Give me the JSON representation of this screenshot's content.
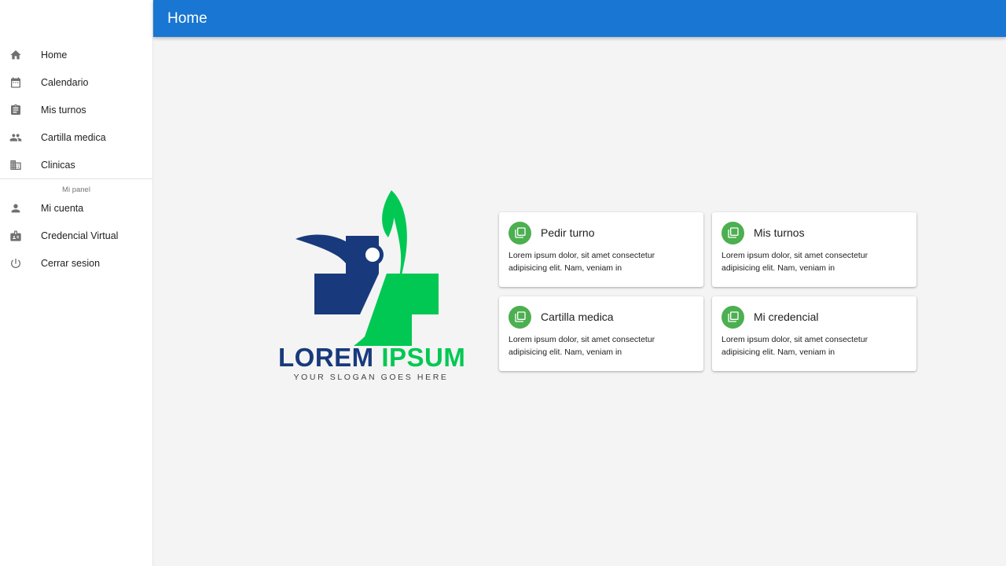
{
  "appbar": {
    "title": "Home",
    "color": "#1976d2"
  },
  "sidebar": {
    "items": [
      {
        "label": "Home",
        "icon": "home-icon"
      },
      {
        "label": "Calendario",
        "icon": "calendar-icon"
      },
      {
        "label": "Mis turnos",
        "icon": "assignment-icon"
      },
      {
        "label": "Cartilla medica",
        "icon": "people-icon"
      },
      {
        "label": "Clinicas",
        "icon": "building-icon"
      }
    ],
    "panel_header": "Mi panel",
    "panel_items": [
      {
        "label": "Mi cuenta",
        "icon": "person-icon"
      },
      {
        "label": "Credencial Virtual",
        "icon": "badge-icon"
      },
      {
        "label": "Cerrar sesion",
        "icon": "power-icon"
      }
    ]
  },
  "logo": {
    "word1": "LOREM",
    "word2": "IPSUM",
    "slogan": "YOUR SLOGAN GOES HERE",
    "colors": {
      "blue": "#183a7c",
      "green": "#00c853"
    }
  },
  "cards": [
    {
      "title": "Pedir turno",
      "text": "Lorem ipsum dolor, sit amet consectetur adipisicing elit. Nam, veniam in",
      "icon": "library-icon"
    },
    {
      "title": "Mis turnos",
      "text": "Lorem ipsum dolor, sit amet consectetur adipisicing elit. Nam, veniam in",
      "icon": "library-icon"
    },
    {
      "title": "Cartilla medica",
      "text": "Lorem ipsum dolor, sit amet consectetur adipisicing elit. Nam, veniam in",
      "icon": "library-icon"
    },
    {
      "title": "Mi credencial",
      "text": "Lorem ipsum dolor, sit amet consectetur adipisicing elit. Nam, veniam in",
      "icon": "library-icon"
    }
  ],
  "card_icon_color": "#4caf50"
}
